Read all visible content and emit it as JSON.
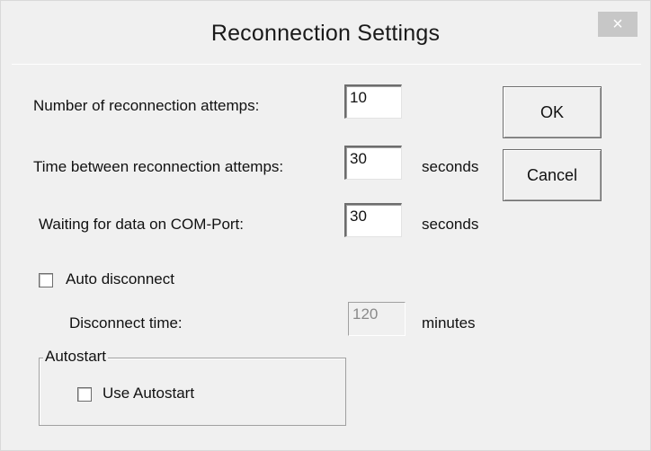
{
  "window": {
    "title": "Reconnection Settings",
    "close_glyph": "×"
  },
  "fields": {
    "reconnection_attempts": {
      "label": "Number of reconnection attemps:",
      "value": "10"
    },
    "time_between": {
      "label": "Time between reconnection attemps:",
      "value": "30",
      "unit": "seconds"
    },
    "waiting_data": {
      "label": "Waiting for data on COM-Port:",
      "value": "30",
      "unit": "seconds"
    }
  },
  "auto_disconnect": {
    "label": "Auto disconnect",
    "checked": false,
    "time_label": "Disconnect time:",
    "time_value": "120",
    "time_unit": "minutes"
  },
  "autostart": {
    "group_label": "Autostart",
    "checkbox_label": "Use Autostart",
    "checked": false
  },
  "buttons": {
    "ok": "OK",
    "cancel": "Cancel"
  },
  "icons": {
    "close": "close-icon",
    "checkbox": "checkbox-unchecked-icon"
  },
  "colors": {
    "window_bg": "#f0f0f0",
    "close_bg": "#c7c7c7"
  }
}
